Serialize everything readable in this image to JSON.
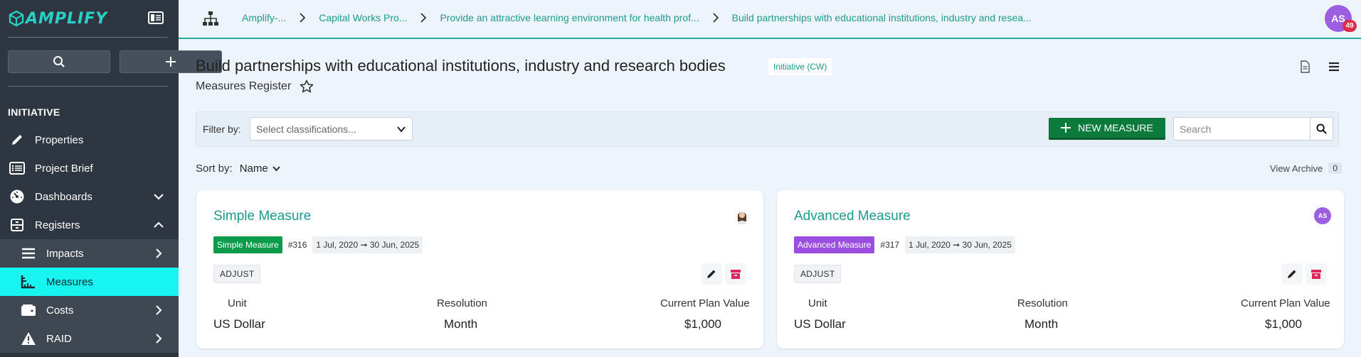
{
  "app": {
    "logo_text": "AMPLIFY"
  },
  "sidebar": {
    "section_title": "INITIATIVE",
    "items": [
      {
        "label": "Properties",
        "icon": "pencil-icon"
      },
      {
        "label": "Project Brief",
        "icon": "list-icon"
      },
      {
        "label": "Dashboards",
        "icon": "gauge-icon",
        "chevron": "chevron-down-icon"
      },
      {
        "label": "Registers",
        "icon": "archive-icon",
        "chevron": "chevron-up-icon"
      },
      {
        "label": "Impacts",
        "icon": "bars-icon",
        "chevron": "chevron-right-icon"
      },
      {
        "label": "Measures",
        "icon": "ruler-icon",
        "active": true
      },
      {
        "label": "Costs",
        "icon": "wallet-icon",
        "chevron": "chevron-right-icon"
      },
      {
        "label": "RAID",
        "icon": "warning-icon",
        "chevron": "chevron-right-icon"
      }
    ]
  },
  "breadcrumbs": [
    "Amplify-...",
    "Capital Works Pro...",
    "Provide an attractive learning environment for health prof...",
    "Build partnerships with educational institutions, industry and resea..."
  ],
  "user": {
    "initials": "AS",
    "notifications": "49"
  },
  "header": {
    "title": "Build partnerships with educational institutions, industry and research bodies",
    "type_badge": "Initiative (CW)",
    "subtitle": "Measures Register"
  },
  "filter": {
    "label": "Filter by:",
    "placeholder": "Select classifications..."
  },
  "new_button": {
    "label": "NEW MEASURE"
  },
  "search": {
    "placeholder": "Search"
  },
  "sort": {
    "label": "Sort by:",
    "value": "Name"
  },
  "archive": {
    "label": "View Archive",
    "count": "0"
  },
  "colors": {
    "accent": "#1d9a8c",
    "simple": "#0b9b4a",
    "advanced": "#9b4fe0",
    "active_nav": "#18f5f0"
  },
  "cards": [
    {
      "title": "Simple Measure",
      "category": "Simple Measure",
      "id": "#316",
      "dates": "1 Jul, 2020 ➞ 30 Jun, 2025",
      "adjust": "ADJUST",
      "columns": [
        {
          "header": "Unit",
          "value": "US Dollar"
        },
        {
          "header": "Resolution",
          "value": "Month"
        },
        {
          "header": "Current Plan Value",
          "value": "$1,000"
        }
      ]
    },
    {
      "title": "Advanced Measure",
      "category": "Advanced Measure",
      "id": "#317",
      "dates": "1 Jul, 2020 ➞ 30 Jun, 2025",
      "adjust": "ADJUST",
      "owner_initials": "AS",
      "columns": [
        {
          "header": "Unit",
          "value": "US Dollar"
        },
        {
          "header": "Resolution",
          "value": "Month"
        },
        {
          "header": "Current Plan Value",
          "value": "$1,000"
        }
      ]
    }
  ]
}
